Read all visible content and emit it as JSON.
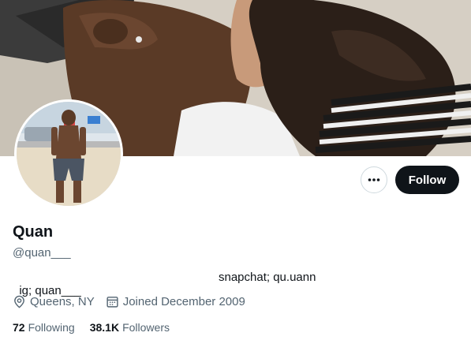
{
  "profile": {
    "name": "Quan",
    "handle": "@quan___",
    "bio_part1": "ig; quan___",
    "bio_part2": "snapchat; qu.uann",
    "location": "Queens, NY",
    "joined": "Joined December 2009",
    "following_count": "72",
    "following_label": "Following",
    "followers_count": "38.1K",
    "followers_label": "Followers"
  },
  "actions": {
    "follow_label": "Follow"
  },
  "icons": {
    "more": "more-options-icon",
    "location": "location-pin-icon",
    "calendar": "calendar-icon"
  },
  "colors": {
    "follow_bg": "#0f1419",
    "muted_text": "#536471"
  }
}
